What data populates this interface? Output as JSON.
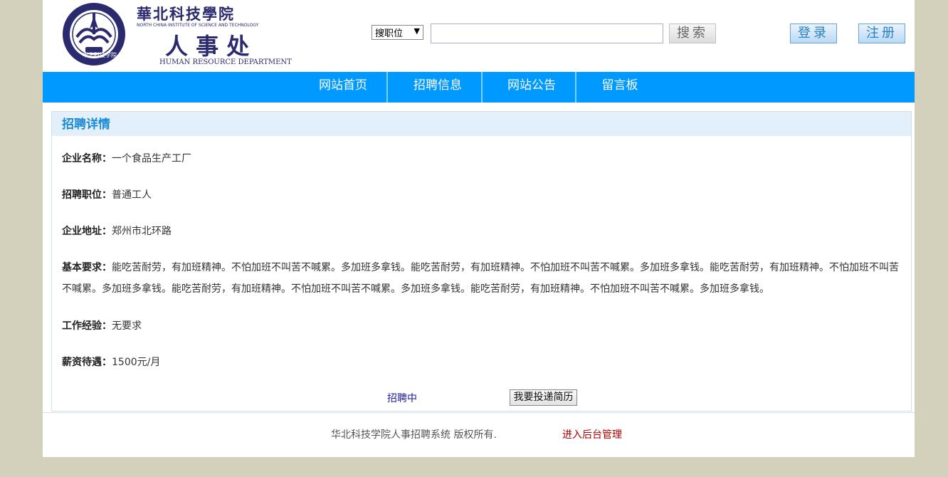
{
  "header": {
    "logo": {
      "college_name_cn": "華北科技學院",
      "college_name_en": "NORTH CHINA INSTITUTE OF SCIENCE AND TECHNOLOGY",
      "dept_name_cn": "人 事 处",
      "dept_name_en": "HUMAN RESOURCE DEPARTMENT",
      "seal_text": "华北科技学院",
      "seal_ring_text": "NORTH CHINA INSTITUTE OF SCIENCE & TECHNOLOGY"
    },
    "search": {
      "select_value": "搜职位",
      "input_value": "",
      "button_label": "搜索"
    },
    "login_label": "登录",
    "register_label": "注册"
  },
  "nav": {
    "items": [
      {
        "label": "网站首页"
      },
      {
        "label": "招聘信息"
      },
      {
        "label": "网站公告"
      },
      {
        "label": "留言板"
      }
    ]
  },
  "detail": {
    "title": "招聘详情",
    "fields": [
      {
        "label": "企业名称：",
        "value": "一个食品生产工厂"
      },
      {
        "label": "招聘职位：",
        "value": "普通工人"
      },
      {
        "label": "企业地址：",
        "value": "郑州市北环路"
      },
      {
        "label": "基本要求：",
        "value": "能吃苦耐劳，有加班精神。不怕加班不叫苦不喊累。多加班多拿钱。能吃苦耐劳，有加班精神。不怕加班不叫苦不喊累。多加班多拿钱。能吃苦耐劳，有加班精神。不怕加班不叫苦不喊累。多加班多拿钱。能吃苦耐劳，有加班精神。不怕加班不叫苦不喊累。多加班多拿钱。能吃苦耐劳，有加班精神。不怕加班不叫苦不喊累。多加班多拿钱。"
      },
      {
        "label": "工作经验：",
        "value": "无要求"
      },
      {
        "label": "薪资待遇：",
        "value": "1500元/月"
      }
    ],
    "status": "招聘中",
    "apply_label": "我要投递简历"
  },
  "footer": {
    "copyright": "华北科技学院人事招聘系统 版权所有.",
    "admin_link": "进入后台管理"
  },
  "colors": {
    "nav_bg": "#0099ff",
    "panel_title_bg": "#e3effb",
    "page_bg": "#d3d0bc",
    "logo_navy": "#2b2a6e"
  }
}
